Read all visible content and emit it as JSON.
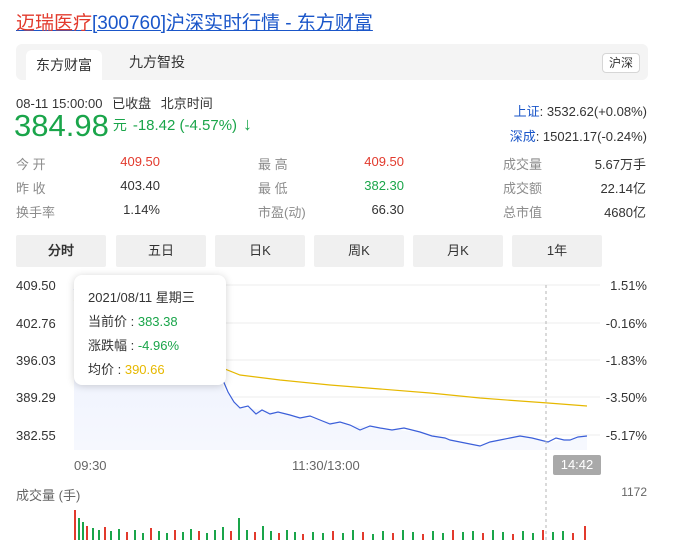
{
  "header": {
    "title_company": "迈瑞医疗",
    "title_rest": "[300760]沪深实时行情 - 东方财富"
  },
  "tabs": {
    "items": [
      "东方财富",
      "九方智投"
    ],
    "market_badge": "沪深"
  },
  "quote": {
    "datetime": "08-11 15:00:00",
    "status": "已收盘",
    "timezone": "北京时间",
    "price": "384.98",
    "unit": "元",
    "change": "-18.42 (-4.57%)",
    "direction": "down"
  },
  "indices": {
    "sh_label": "上证",
    "sh_value": ": 3532.62(+0.08%)",
    "sz_label": "深成",
    "sz_value": ": 15021.17(-0.24%)"
  },
  "stats": {
    "open_label": "今  开",
    "open": "409.50",
    "high_label": "最  高",
    "high": "409.50",
    "volume_label": "成交量",
    "volume": "5.67万手",
    "prev_label": "昨  收",
    "prev": "403.40",
    "low_label": "最  低",
    "low": "382.30",
    "amount_label": "成交额",
    "amount": "22.14亿",
    "turnover_label": "换手率",
    "turnover": "1.14%",
    "pe_label": "市盈(动)",
    "pe": "66.30",
    "mcap_label": "总市值",
    "mcap": "4680亿"
  },
  "periods": [
    "分时",
    "五日",
    "日K",
    "周K",
    "月K",
    "1年"
  ],
  "chart_data": {
    "type": "line",
    "y_left_ticks": [
      "409.50",
      "402.76",
      "396.03",
      "389.29",
      "382.55"
    ],
    "y_right_ticks": [
      "1.51%",
      "-0.16%",
      "-1.83%",
      "-3.50%",
      "-5.17%"
    ],
    "x_ticks": [
      "09:30",
      "11:30/13:00"
    ],
    "crosshair_time": "14:42",
    "volume_title": "成交量 (手)",
    "volume_max": "1172",
    "colors": {
      "price": "#3b5fd9",
      "avg": "#e6b800",
      "up": "#e23a2d",
      "down": "#1aa54a"
    },
    "series": [
      {
        "name": "当前价",
        "values": []
      },
      {
        "name": "均价",
        "values": []
      }
    ]
  },
  "tooltip": {
    "date": "2021/08/11 星期三",
    "price_label": "当前价 : ",
    "price": "383.38",
    "pct_label": "涨跌幅 : ",
    "pct": "-4.96%",
    "avg_label": "均价 : ",
    "avg": "390.66"
  }
}
